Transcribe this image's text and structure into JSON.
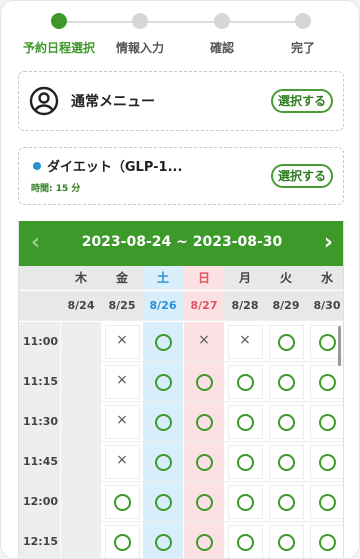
{
  "stepper": {
    "steps": [
      {
        "label": "予約日程選択",
        "active": true
      },
      {
        "label": "情報入力",
        "active": false
      },
      {
        "label": "確認",
        "active": false
      },
      {
        "label": "完了",
        "active": false
      }
    ]
  },
  "menu": {
    "title": "通常メニュー",
    "button": "選択する",
    "icon": "user-circle-icon"
  },
  "course": {
    "title": "ダイエット（GLP-1...",
    "time": "時間: 15 分",
    "button": "選択する",
    "dot_color": "#2a8fd4"
  },
  "calendar": {
    "range": "2023-08-24 ~ 2023-08-30",
    "prev": "‹",
    "next": "›",
    "weekdays": [
      "木",
      "金",
      "土",
      "日",
      "月",
      "火",
      "水"
    ],
    "dates": [
      "8/24",
      "8/25",
      "8/26",
      "8/27",
      "8/28",
      "8/29",
      "8/30"
    ],
    "rows": [
      {
        "time": "11:00",
        "slots": [
          "",
          "×",
          "○",
          "×",
          "×",
          "○",
          "○"
        ]
      },
      {
        "time": "11:15",
        "slots": [
          "",
          "×",
          "○",
          "○",
          "○",
          "○",
          "○"
        ]
      },
      {
        "time": "11:30",
        "slots": [
          "",
          "×",
          "○",
          "○",
          "○",
          "○",
          "○"
        ]
      },
      {
        "time": "11:45",
        "slots": [
          "",
          "×",
          "○",
          "○",
          "○",
          "○",
          "○"
        ]
      },
      {
        "time": "12:00",
        "slots": [
          "",
          "○",
          "○",
          "○",
          "○",
          "○",
          "○"
        ]
      },
      {
        "time": "12:15",
        "slots": [
          "",
          "○",
          "○",
          "○",
          "○",
          "○",
          "○"
        ]
      }
    ]
  },
  "colors": {
    "accent": "#3d9a2a",
    "saturday": "#2a8fd4",
    "sunday": "#e0555d"
  }
}
